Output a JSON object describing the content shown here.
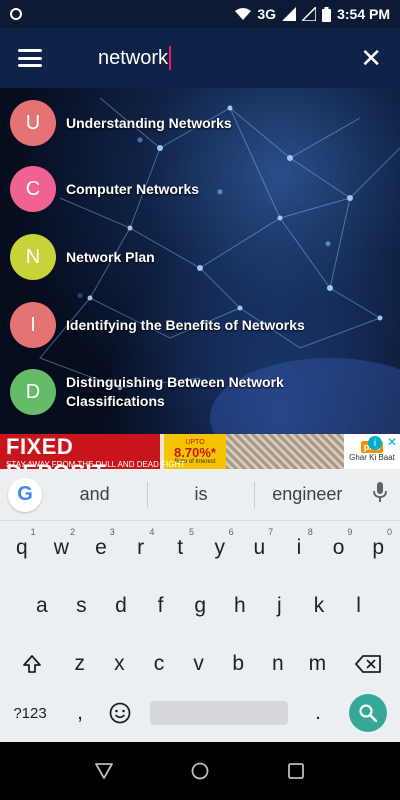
{
  "status_bar": {
    "network": "3G",
    "time": "3:54 PM"
  },
  "app_bar": {
    "search_value": "network"
  },
  "results": [
    {
      "initial": "U",
      "label": "Understanding Networks",
      "color": "#e57373"
    },
    {
      "initial": "C",
      "label": "Computer Networks",
      "color": "#f06292"
    },
    {
      "initial": "N",
      "label": "Network Plan",
      "color": "#c6d43a"
    },
    {
      "initial": "I",
      "label": "Identifying the Benefits of Networks",
      "color": "#e57373"
    },
    {
      "initial": "D",
      "label": "Distinguishing Between Network Classifications",
      "color": "#66bb6a"
    }
  ],
  "ad": {
    "title": "FIXED DEPOSIT.",
    "subtitle": "STAY AWAY FROM THE DULL AND DEAD FIGHT",
    "upto": "UPTO",
    "rate": "8.70%*",
    "rate_label": "Rate of Interest",
    "brand": "pnb",
    "brand_sub": "Ghar Ki Baat"
  },
  "keyboard": {
    "suggestions": [
      "and",
      "is",
      "engineer"
    ],
    "row1": [
      {
        "k": "q",
        "h": "1"
      },
      {
        "k": "w",
        "h": "2"
      },
      {
        "k": "e",
        "h": "3"
      },
      {
        "k": "r",
        "h": "4"
      },
      {
        "k": "t",
        "h": "5"
      },
      {
        "k": "y",
        "h": "6"
      },
      {
        "k": "u",
        "h": "7"
      },
      {
        "k": "i",
        "h": "8"
      },
      {
        "k": "o",
        "h": "9"
      },
      {
        "k": "p",
        "h": "0"
      }
    ],
    "row2": [
      "a",
      "s",
      "d",
      "f",
      "g",
      "h",
      "j",
      "k",
      "l"
    ],
    "row3": [
      "z",
      "x",
      "c",
      "v",
      "b",
      "n",
      "m"
    ],
    "symbols_label": "?123",
    "comma": ",",
    "period": "."
  }
}
